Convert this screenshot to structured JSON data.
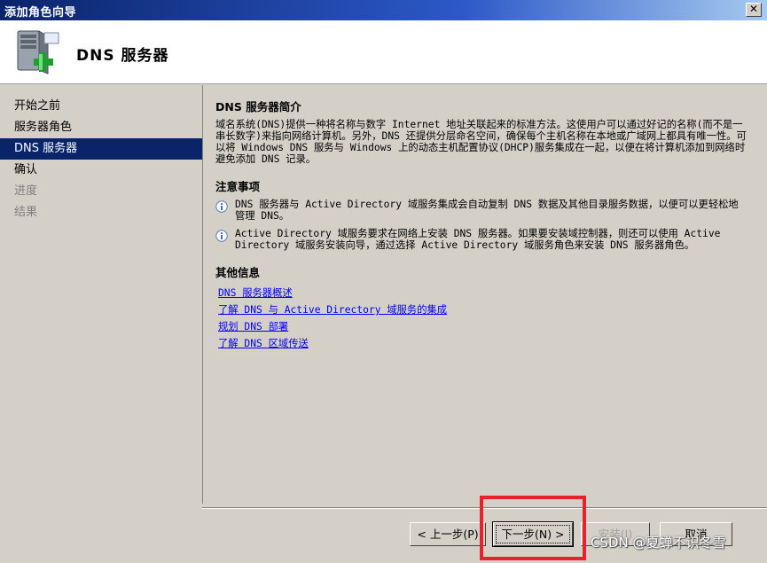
{
  "window": {
    "title": "添加角色向导",
    "close_label": "✕"
  },
  "header": {
    "title": "DNS 服务器",
    "icon": "server-add-icon"
  },
  "sidebar": {
    "items": [
      {
        "label": "开始之前",
        "state": "normal"
      },
      {
        "label": "服务器角色",
        "state": "normal"
      },
      {
        "label": "DNS 服务器",
        "state": "active"
      },
      {
        "label": "确认",
        "state": "normal"
      },
      {
        "label": "进度",
        "state": "disabled"
      },
      {
        "label": "结果",
        "state": "disabled"
      }
    ]
  },
  "content": {
    "intro_heading": "DNS 服务器简介",
    "intro_text": "域名系统(DNS)提供一种将名称与数字 Internet 地址关联起来的标准方法。这使用户可以通过好记的名称(而不是一串长数字)来指向网络计算机。另外，DNS 还提供分层命名空间，确保每个主机名称在本地或广域网上都具有唯一性。可以将 Windows DNS 服务与 Windows 上的动态主机配置协议(DHCP)服务集成在一起，以便在将计算机添加到网络时避免添加 DNS 记录。",
    "notes_heading": "注意事项",
    "notes": [
      "DNS 服务器与 Active Directory 域服务集成会自动复制 DNS 数据及其他目录服务数据，以便可以更轻松地管理 DNS。",
      "Active Directory 域服务要求在网络上安装 DNS 服务器。如果要安装域控制器，则还可以使用 Active Directory 域服务安装向导，通过选择 Active Directory 域服务角色来安装 DNS 服务器角色。"
    ],
    "more_heading": "其他信息",
    "links": [
      "DNS 服务器概述",
      "了解 DNS 与 Active Directory 域服务的集成",
      "规划 DNS 部署",
      "了解 DNS 区域传送"
    ]
  },
  "buttons": {
    "back": "< 上一步(P)",
    "next": "下一步(N) >",
    "install": "安装(I)",
    "cancel": "取消"
  },
  "watermark": "CSDN @夏蝉不识冬雪",
  "colors": {
    "titlebar": "#0a246a",
    "highlight": "#e8212b",
    "link": "#0000ee"
  }
}
